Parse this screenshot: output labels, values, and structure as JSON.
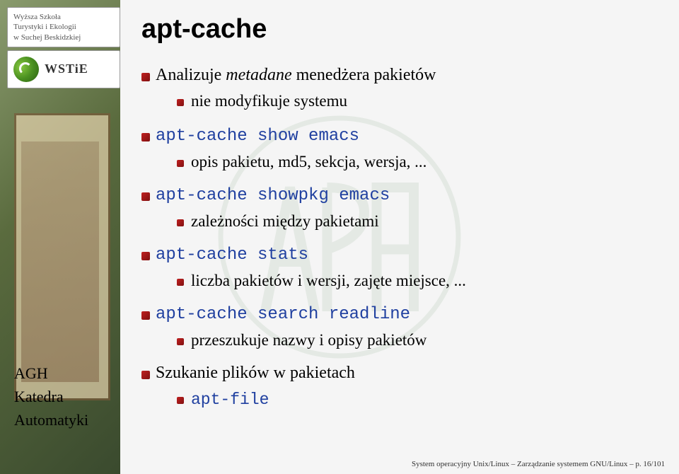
{
  "logo": {
    "line1": "Wyższa Szkoła",
    "line2": "Turystyki i Ekologii",
    "line3": "w Suchej Beskidzkiej",
    "acronym": "WSTiE"
  },
  "title": "apt-cache",
  "items": {
    "intro_l1_part1": "Analizuje ",
    "intro_l1_italic": "metadane",
    "intro_l1_part2": " menedżera pakietów",
    "intro_sub": "nie modyfikuje systemu",
    "show_cmd": "apt-cache show emacs",
    "show_sub": "opis pakietu, md5, sekcja, wersja, ...",
    "showpkg_cmd": "apt-cache showpkg emacs",
    "showpkg_sub": "zależności między pakietami",
    "stats_cmd": "apt-cache stats",
    "stats_sub": "liczba pakietów i wersji, zajęte miejsce, ...",
    "search_cmd": "apt-cache search readline",
    "search_sub": "przeszukuje nazwy i opisy pakietów",
    "files_l1": "Szukanie plików w pakietach",
    "files_sub": "apt-file"
  },
  "sidebar": {
    "line1": "AGH",
    "line2": "Katedra",
    "line3": "Automatyki"
  },
  "footer": "System operacyjny Unix/Linux – Zarządzanie systemem GNU/Linux – p. 16/101"
}
